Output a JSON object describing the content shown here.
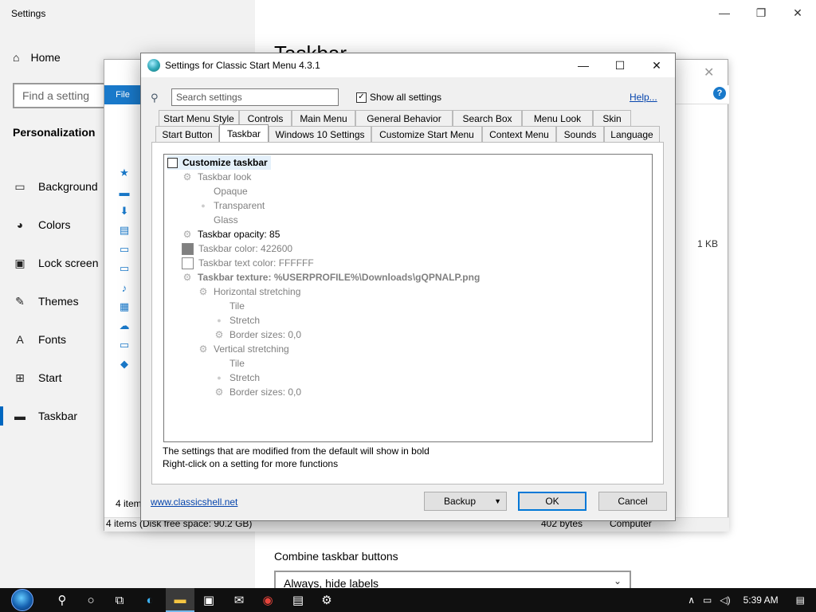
{
  "settings_app": {
    "title": "Settings",
    "home": "Home",
    "find_placeholder": "Find a setting",
    "section": "Personalization",
    "nav": [
      {
        "label": "Background",
        "icon": "picture-icon"
      },
      {
        "label": "Colors",
        "icon": "palette-icon"
      },
      {
        "label": "Lock screen",
        "icon": "lock-screen-icon"
      },
      {
        "label": "Themes",
        "icon": "themes-icon"
      },
      {
        "label": "Fonts",
        "icon": "fonts-icon"
      },
      {
        "label": "Start",
        "icon": "start-icon"
      },
      {
        "label": "Taskbar",
        "icon": "taskbar-icon",
        "active": true
      }
    ],
    "page_title_partial": "Taskbar",
    "combine_label": "Combine taskbar buttons",
    "combine_value": "Always, hide labels"
  },
  "explorer": {
    "file_tab": "File",
    "items_short": "4 item",
    "status": "4 items (Disk free space: 90.2 GB)",
    "file_size": "1 KB",
    "status_size": "402 bytes",
    "status_location": "Computer"
  },
  "dialog": {
    "title": "Settings for Classic Start Menu 4.3.1",
    "search_placeholder": "Search settings",
    "show_all_label": "Show all settings",
    "show_all_checked": true,
    "help": "Help...",
    "tabs_row1": [
      "Start Menu Style",
      "Controls",
      "Main Menu",
      "General Behavior",
      "Search Box",
      "Menu Look",
      "Skin"
    ],
    "tabs_row2": [
      "Start Button",
      "Taskbar",
      "Windows 10 Settings",
      "Customize Start Menu",
      "Context Menu",
      "Sounds",
      "Language"
    ],
    "active_tab": "Taskbar",
    "tree": [
      {
        "label": "Customize taskbar"
      },
      {
        "label": "Taskbar look"
      },
      {
        "label": "Opaque"
      },
      {
        "label": "Transparent"
      },
      {
        "label": "Glass"
      },
      {
        "label": "Taskbar opacity: 85"
      },
      {
        "label": "Taskbar color: 422600",
        "swatch": "#808080"
      },
      {
        "label": "Taskbar text color: FFFFFF",
        "swatch": "#FFFFFF"
      },
      {
        "label": "Taskbar texture: %USERPROFILE%\\Downloads\\gQPNALP.png"
      },
      {
        "label": "Horizontal stretching"
      },
      {
        "label": "Tile"
      },
      {
        "label": "Stretch"
      },
      {
        "label": "Border sizes: 0,0"
      },
      {
        "label": "Vertical stretching"
      },
      {
        "label": "Tile"
      },
      {
        "label": "Stretch"
      },
      {
        "label": "Border sizes: 0,0"
      }
    ],
    "note1": "The settings that are modified from the default will show in bold",
    "note2": "Right-click on a setting for more functions",
    "link": "www.classicshell.net",
    "backup": "Backup",
    "ok": "OK",
    "cancel": "Cancel"
  },
  "taskbar": {
    "time": "5:39 AM"
  }
}
